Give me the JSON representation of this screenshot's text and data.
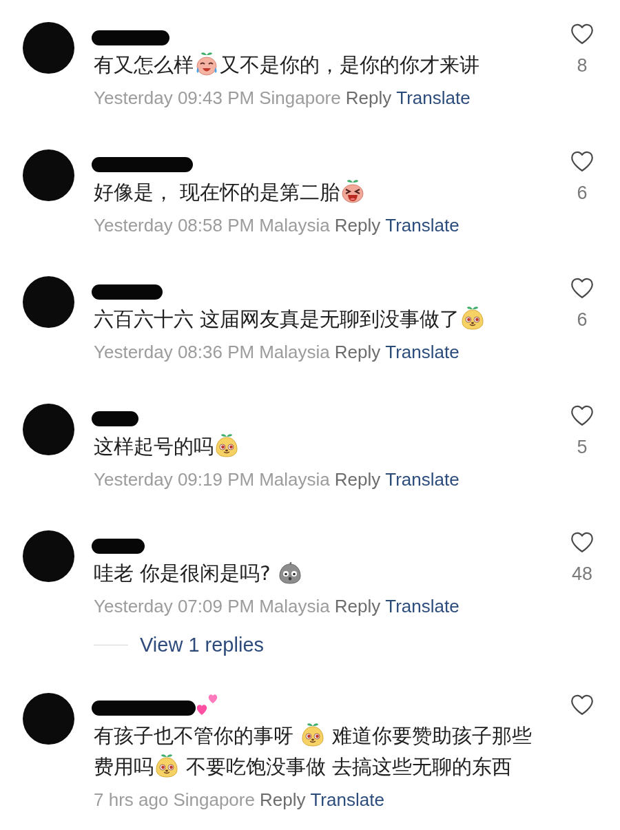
{
  "comments": [
    {
      "name": [
        {
          "kind": "redacted"
        }
      ],
      "text": [
        {
          "kind": "text",
          "text": "有又怎么样"
        },
        {
          "kind": "crying"
        },
        {
          "kind": "text",
          "text": "又不是你的，是你的你才来讲"
        }
      ],
      "time": "Yesterday 09:43 PM",
      "location": "Singapore",
      "reply": "Reply",
      "translate": "Translate",
      "liked": false,
      "likes": "8"
    },
    {
      "name": [
        {
          "kind": "redacted"
        }
      ],
      "text": [
        {
          "kind": "text",
          "text": "好像是， 现在怀的是第二胎"
        },
        {
          "kind": "laughing"
        }
      ],
      "time": "Yesterday 08:58 PM",
      "location": "Malaysia",
      "reply": "Reply",
      "translate": "Translate",
      "liked": false,
      "likes": "6"
    },
    {
      "name": [
        {
          "kind": "redacted"
        }
      ],
      "text": [
        {
          "kind": "text",
          "text": "六百六十六 这届网友真是无聊到没事做了"
        },
        {
          "kind": "smirking"
        }
      ],
      "time": "Yesterday 08:36 PM",
      "location": "Malaysia",
      "reply": "Reply",
      "translate": "Translate",
      "liked": false,
      "likes": "6"
    },
    {
      "name": [
        {
          "kind": "redacted"
        }
      ],
      "text": [
        {
          "kind": "text",
          "text": "这样起号的吗"
        },
        {
          "kind": "smirking"
        }
      ],
      "time": "Yesterday 09:19 PM",
      "location": "Malaysia",
      "reply": "Reply",
      "translate": "Translate",
      "liked": false,
      "likes": "5"
    },
    {
      "name": [
        {
          "kind": "redacted"
        }
      ],
      "text": [
        {
          "kind": "text",
          "text": "哇老 你是很闲是吗? "
        },
        {
          "kind": "surprised"
        }
      ],
      "time": "Yesterday 07:09 PM",
      "location": "Malaysia",
      "reply": "Reply",
      "translate": "Translate",
      "liked": false,
      "likes": "48",
      "replies": "View 1 replies"
    },
    {
      "name": [
        {
          "kind": "redacted"
        },
        {
          "kind": "hearts"
        }
      ],
      "text": [
        {
          "kind": "text",
          "text": "有孩子也不管你的事呀 "
        },
        {
          "kind": "smirking"
        },
        {
          "kind": "text",
          "text": " 难道你要赞助孩子那些"
        },
        {
          "kind": "text",
          "text": "费用吗"
        },
        {
          "kind": "smirking"
        },
        {
          "kind": "text",
          "text": " 不要吃饱没事做 去搞这些无聊的东西"
        }
      ],
      "time": "7 hrs ago",
      "location": "Singapore",
      "reply": "Reply",
      "translate": "Translate",
      "liked": false
    }
  ]
}
